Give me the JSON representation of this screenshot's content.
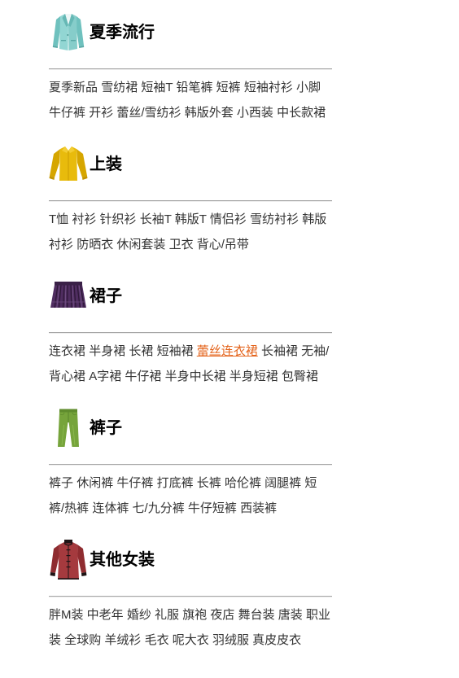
{
  "colors": {
    "link": "#333333",
    "title": "#000000",
    "link_highlight": "#e4641c",
    "divider": "#a6a6a6"
  },
  "sections": [
    {
      "title": "夏季流行",
      "icon": "blazer-icon",
      "links": [
        {
          "text": "夏季新品"
        },
        {
          "text": "雪纺裙"
        },
        {
          "text": "短袖T"
        },
        {
          "text": "铅笔裤"
        },
        {
          "text": "短裤"
        },
        {
          "text": "短袖衬衫"
        },
        {
          "text": "小脚牛仔裤"
        },
        {
          "text": "开衫"
        },
        {
          "text": "蕾丝/雪纺衫"
        },
        {
          "text": "韩版外套"
        },
        {
          "text": "小西装"
        },
        {
          "text": "中长款裙"
        }
      ]
    },
    {
      "title": "上装",
      "icon": "shirt-icon",
      "links": [
        {
          "text": "T恤"
        },
        {
          "text": "衬衫"
        },
        {
          "text": "针织衫"
        },
        {
          "text": "长袖T"
        },
        {
          "text": "韩版T"
        },
        {
          "text": "情侣衫"
        },
        {
          "text": "雪纺衬衫"
        },
        {
          "text": "韩版衬衫"
        },
        {
          "text": "防晒衣"
        },
        {
          "text": "休闲套装"
        },
        {
          "text": "卫衣"
        },
        {
          "text": "背心/吊带"
        }
      ]
    },
    {
      "title": "裙子",
      "icon": "skirt-icon",
      "links": [
        {
          "text": "连衣裙"
        },
        {
          "text": "半身裙"
        },
        {
          "text": "长裙"
        },
        {
          "text": "短袖裙"
        },
        {
          "text": "蕾丝连衣裙",
          "highlighted": true
        },
        {
          "text": "长袖裙"
        },
        {
          "text": "无袖/背心裙"
        },
        {
          "text": "A字裙"
        },
        {
          "text": "牛仔裙"
        },
        {
          "text": "半身中长裙"
        },
        {
          "text": "半身短裙"
        },
        {
          "text": "包臀裙"
        }
      ]
    },
    {
      "title": "裤子",
      "icon": "pants-icon",
      "links": [
        {
          "text": "裤子"
        },
        {
          "text": "休闲裤"
        },
        {
          "text": "牛仔裤"
        },
        {
          "text": "打底裤"
        },
        {
          "text": "长裤"
        },
        {
          "text": "哈伦裤"
        },
        {
          "text": "阔腿裤"
        },
        {
          "text": "短裤/热裤"
        },
        {
          "text": "连体裤"
        },
        {
          "text": "七/九分裤"
        },
        {
          "text": "牛仔短裤"
        },
        {
          "text": "西装裤"
        }
      ]
    },
    {
      "title": "其他女装",
      "icon": "coat-icon",
      "links": [
        {
          "text": "胖M装"
        },
        {
          "text": "中老年"
        },
        {
          "text": "婚纱"
        },
        {
          "text": "礼服"
        },
        {
          "text": "旗袍"
        },
        {
          "text": "夜店"
        },
        {
          "text": "舞台装"
        },
        {
          "text": "唐装"
        },
        {
          "text": "职业装"
        },
        {
          "text": "全球购"
        },
        {
          "text": "羊绒衫"
        },
        {
          "text": "毛衣"
        },
        {
          "text": "呢大衣"
        },
        {
          "text": "羽绒服"
        },
        {
          "text": "真皮皮衣"
        }
      ]
    }
  ]
}
